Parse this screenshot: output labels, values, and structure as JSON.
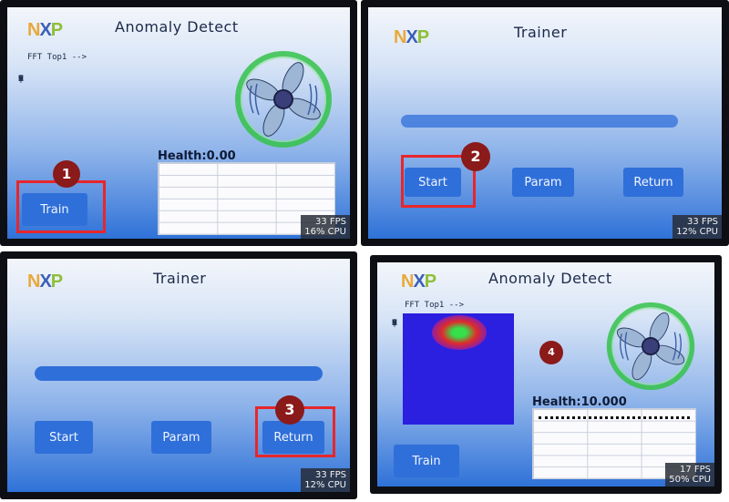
{
  "logo_text": "NXP",
  "panels": [
    {
      "title": "Anomaly Detect",
      "fft_label": "FFT Top1 -->",
      "rms_letters": [
        "R",
        "M",
        "S",
        "|",
        "V"
      ],
      "health": "Health:0.00",
      "train_label": "Train",
      "badge": "1",
      "fps": "33 FPS",
      "cpu": "16% CPU"
    },
    {
      "title": "Trainer",
      "start_label": "Start",
      "param_label": "Param",
      "return_label": "Return",
      "badge": "2",
      "fps": "33 FPS",
      "cpu": "12% CPU"
    },
    {
      "title": "Trainer",
      "start_label": "Start",
      "param_label": "Param",
      "return_label": "Return",
      "badge": "3",
      "fps": "33 FPS",
      "cpu": "12% CPU"
    },
    {
      "title": "Anomaly Detect",
      "fft_label": "FFT Top1 -->",
      "rms_letters": [
        "R",
        "M",
        "S",
        "|",
        "V"
      ],
      "health": "Health:10.000",
      "train_label": "Train",
      "badge": "4",
      "fps": "17 FPS",
      "cpu": "50% CPU"
    }
  ],
  "colors": {
    "highlight_box": "#e8262b",
    "badge": "#8b1a1a",
    "button": "#2f6fd9",
    "fan_glow": "#34c24a"
  }
}
